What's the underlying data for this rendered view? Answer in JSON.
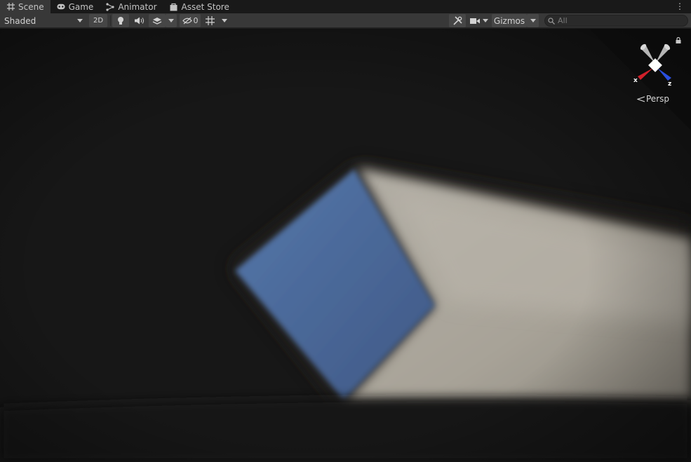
{
  "tabs": [
    {
      "label": "Scene",
      "icon": "grid-icon",
      "active": true
    },
    {
      "label": "Game",
      "icon": "gamepad-icon",
      "active": false
    },
    {
      "label": "Animator",
      "icon": "animator-icon",
      "active": false
    },
    {
      "label": "Asset Store",
      "icon": "store-bag-icon",
      "active": false
    }
  ],
  "toolbar": {
    "draw_mode": "Shaded",
    "mode_2d": "2D",
    "hidden_count": "0",
    "gizmos_label": "Gizmos",
    "search_placeholder": "All"
  },
  "viewport": {
    "projection_label": "Persp",
    "axes": {
      "x": "x",
      "z": "z"
    },
    "colors": {
      "x_axis": "#d0202a",
      "z_axis": "#2a4fe0",
      "sky": "#4a6b9e",
      "floor": "#a9a59c"
    }
  }
}
